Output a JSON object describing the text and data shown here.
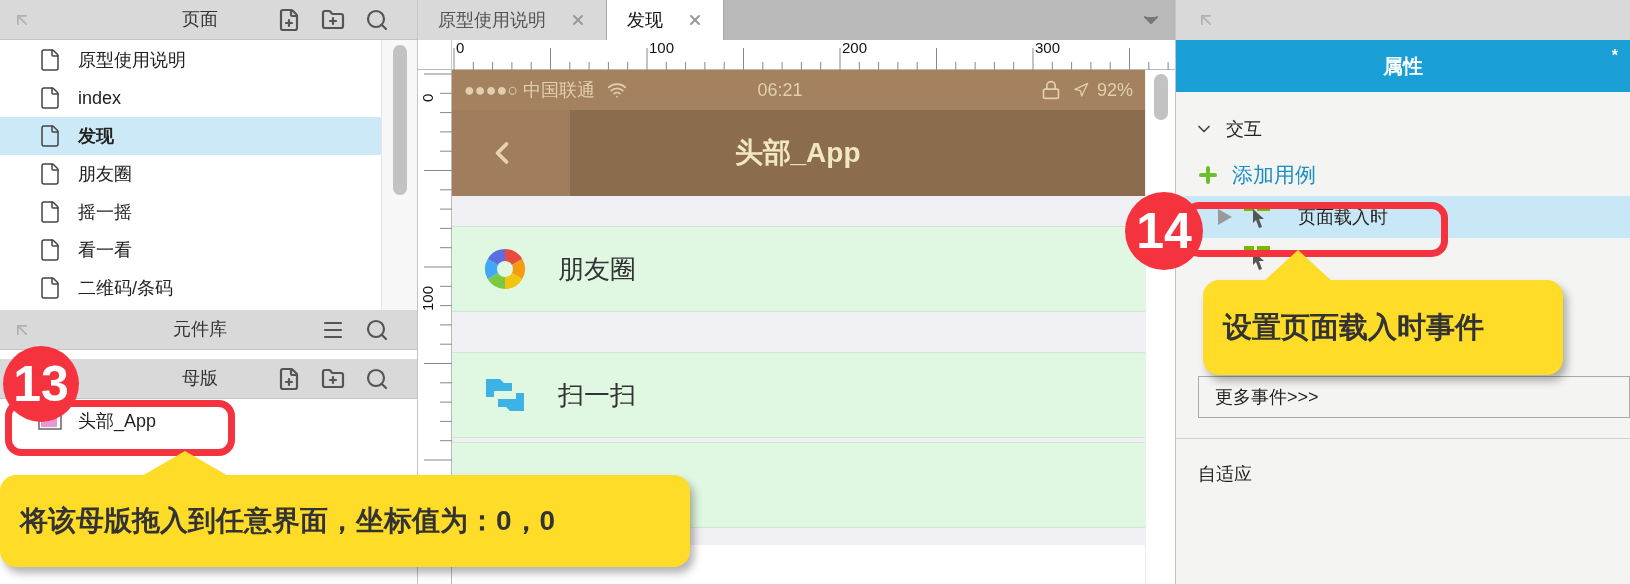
{
  "pages_panel": {
    "title": "页面",
    "pages": [
      {
        "name": "原型使用说明",
        "selected": false
      },
      {
        "name": "index",
        "selected": false
      },
      {
        "name": "发现",
        "selected": true
      },
      {
        "name": "朋友圈",
        "selected": false
      },
      {
        "name": "摇一摇",
        "selected": false
      },
      {
        "name": "看一看",
        "selected": false
      },
      {
        "name": "二维码/条码",
        "selected": false
      }
    ]
  },
  "library_panel": {
    "title": "元件库"
  },
  "masters_panel": {
    "title": "母版",
    "masters": [
      {
        "name": "头部_App"
      }
    ]
  },
  "tabs": [
    {
      "label": "原型使用说明",
      "selected": false
    },
    {
      "label": "发现",
      "selected": true
    }
  ],
  "ruler": {
    "x_ticks": [
      "0",
      "100",
      "200",
      "300"
    ],
    "y_ticks": [
      "0",
      "100"
    ]
  },
  "phone": {
    "status_bar": {
      "carrier": "●●●●○ 中国联通",
      "time": "06:21",
      "battery": "92%"
    },
    "title": "头部_App",
    "rows": [
      {
        "kind": "moments",
        "label": "朋友圈"
      },
      {
        "kind": "scan",
        "label": "扫一扫"
      },
      {
        "kind": "shake"
      }
    ]
  },
  "properties_panel": {
    "title": "属性",
    "modified_mark": "*",
    "section": {
      "title": "交互",
      "expanded": true
    },
    "add_case": "添加用例",
    "events": [
      {
        "label": "页面载入时",
        "selected": true
      },
      {
        "selected": false
      }
    ],
    "more_events": "更多事件>>>",
    "adaptive": "自适应"
  },
  "callouts": [
    {
      "number": "13",
      "text": "将该母版拖入到任意界面，坐标值为：0，0"
    },
    {
      "number": "14",
      "text": "设置页面载入时事件"
    }
  ]
}
